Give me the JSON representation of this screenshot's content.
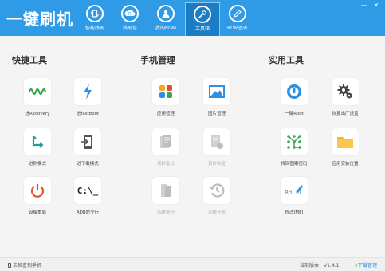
{
  "app": {
    "title": "一键刷机"
  },
  "nav": [
    {
      "label": "智能线刷",
      "icon": "refresh-phone-icon"
    },
    {
      "label": "线刷包",
      "icon": "cloud-r-icon"
    },
    {
      "label": "我的ROM",
      "icon": "user-rom-icon"
    },
    {
      "label": "工具箱",
      "icon": "wrench-icon"
    },
    {
      "label": "ROM签名",
      "icon": "pen-rom-icon"
    }
  ],
  "window_controls": {
    "minimize": "—",
    "close": "✕"
  },
  "sections": {
    "quick": {
      "title": "快捷工具"
    },
    "phone": {
      "title": "手机管理"
    },
    "util": {
      "title": "实用工具"
    }
  },
  "tools": {
    "recovery": {
      "label": "进Recovery",
      "icon": "wave-icon"
    },
    "fastboot": {
      "label": "进fastboot",
      "icon": "lightning-icon"
    },
    "mode": {
      "label": "进刷模式",
      "icon": "arrow-icon"
    },
    "download": {
      "label": "进下载模式",
      "icon": "phone-arrow-icon"
    },
    "reboot": {
      "label": "设备重启",
      "icon": "power-icon"
    },
    "adb": {
      "label": "ADB命令行",
      "icon": "cmd-icon",
      "glyph": "C:\\_"
    },
    "apps": {
      "label": "应用管理",
      "icon": "apps-grid-icon"
    },
    "images": {
      "label": "图片管理",
      "icon": "image-icon"
    },
    "backup": {
      "label": "资料备份",
      "icon": "docs-icon"
    },
    "restore": {
      "label": "资料恢复",
      "icon": "docs-restore-icon"
    },
    "sysbackup": {
      "label": "系统备份",
      "icon": "doc-copy-icon"
    },
    "sysrestore": {
      "label": "系统还原",
      "icon": "clock-restore-icon"
    },
    "root": {
      "label": "一键Root",
      "icon": "root-icon"
    },
    "factory": {
      "label": "恢复出厂设置",
      "icon": "gear-icon"
    },
    "pattern": {
      "label": "找回图案密码",
      "icon": "pattern-icon"
    },
    "appdir": {
      "label": "应用安装位置",
      "icon": "folder-icon"
    },
    "imei": {
      "label": "修改IMEI",
      "icon": "imei-pen-icon"
    }
  },
  "status": {
    "left": "未检查到手机",
    "version": "当前版本：V1.4.1",
    "download": "下载管理"
  },
  "colors": {
    "accent": "#2f9be6",
    "active_tab": "#1b7dc6"
  }
}
